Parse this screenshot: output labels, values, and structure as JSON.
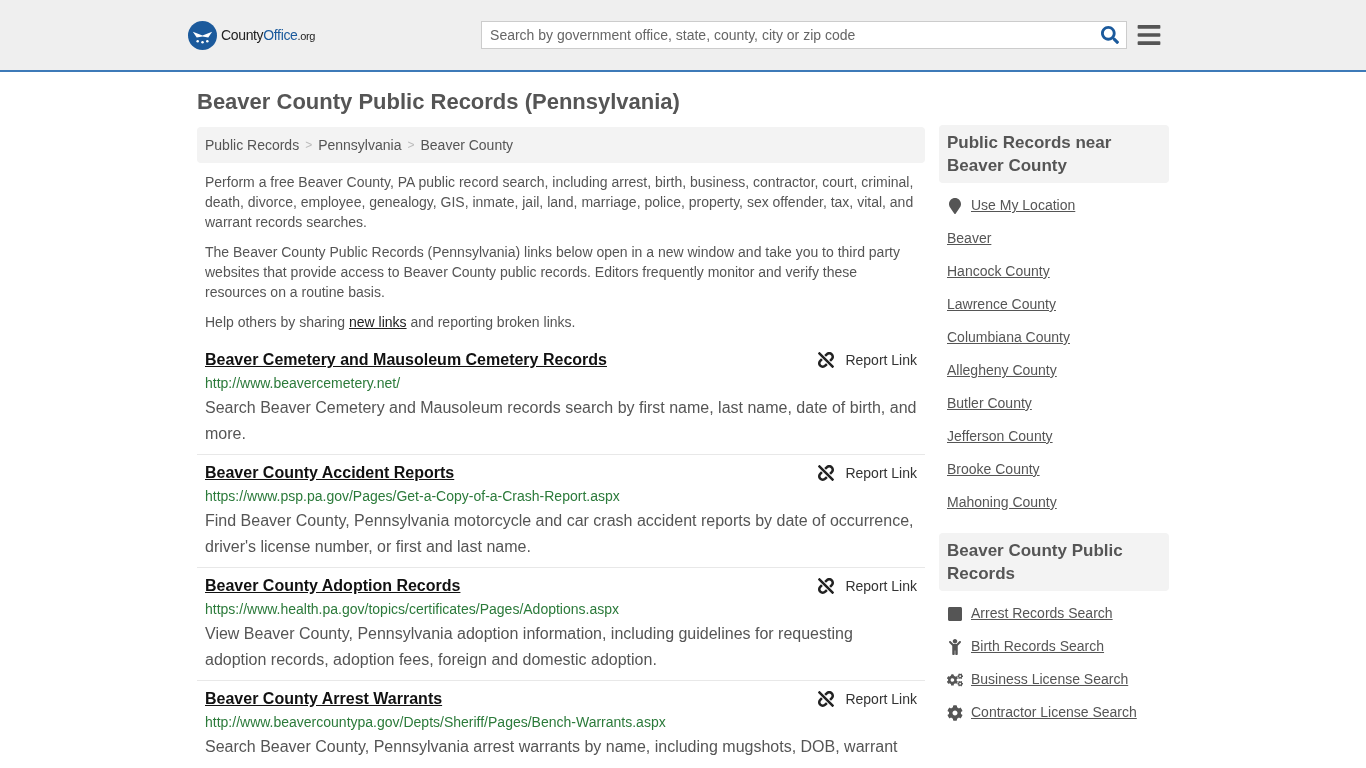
{
  "header": {
    "logo": {
      "part1": "County",
      "part2": "Office",
      "suffix": ".org"
    },
    "search": {
      "placeholder": "Search by government office, state, county, city or zip code"
    }
  },
  "title": "Beaver County Public Records (Pennsylvania)",
  "breadcrumbs": [
    "Public Records",
    "Pennsylvania",
    "Beaver County"
  ],
  "breadcrumb_separator": ">",
  "intro": [
    "Perform a free Beaver County, PA public record search, including arrest, birth, business, contractor, court, criminal, death, divorce, employee, genealogy, GIS, inmate, jail, land, marriage, police, property, sex offender, tax, vital, and warrant records searches.",
    "The Beaver County Public Records (Pennsylvania) links below open in a new window and take you to third party websites that provide access to Beaver County public records. Editors frequently monitor and verify these resources on a routine basis."
  ],
  "help": {
    "before": "Help others by sharing",
    "link": "new links",
    "after": "and reporting broken links."
  },
  "records": [
    {
      "title": "Beaver Cemetery and Mausoleum Cemetery Records",
      "report": "Report Link",
      "url": "http://www.beavercemetery.net/",
      "description": "Search Beaver Cemetery and Mausoleum records search by first name, last name, date of birth, and more."
    },
    {
      "title": "Beaver County Accident Reports",
      "report": "Report Link",
      "url": "https://www.psp.pa.gov/Pages/Get-a-Copy-of-a-Crash-Report.aspx",
      "description": "Find Beaver County, Pennsylvania motorcycle and car crash accident reports by date of occurrence, driver's license number, or first and last name."
    },
    {
      "title": "Beaver County Adoption Records",
      "report": "Report Link",
      "url": "https://www.health.pa.gov/topics/certificates/Pages/Adoptions.aspx",
      "description": "View Beaver County, Pennsylvania adoption information, including guidelines for requesting adoption records, adoption fees, foreign and domestic adoption."
    },
    {
      "title": "Beaver County Arrest Warrants",
      "report": "Report Link",
      "url": "http://www.beavercountypa.gov/Depts/Sheriff/Pages/Bench-Warrants.aspx",
      "description": "Search Beaver County, Pennsylvania arrest warrants by name, including mugshots, DOB, warrant"
    }
  ],
  "sidebar": [
    {
      "heading": "Public Records near Beaver County",
      "items": [
        {
          "label": "Use My Location",
          "kind": "location"
        },
        {
          "label": "Beaver",
          "kind": "plain"
        },
        {
          "label": "Hancock County",
          "kind": "plain"
        },
        {
          "label": "Lawrence County",
          "kind": "plain"
        },
        {
          "label": "Columbiana County",
          "kind": "plain"
        },
        {
          "label": "Allegheny County",
          "kind": "plain"
        },
        {
          "label": "Butler County",
          "kind": "plain"
        },
        {
          "label": "Jefferson County",
          "kind": "plain"
        },
        {
          "label": "Brooke County",
          "kind": "plain"
        },
        {
          "label": "Mahoning County",
          "kind": "plain"
        }
      ]
    },
    {
      "heading": "Beaver County Public Records",
      "items": [
        {
          "label": "Arrest Records Search",
          "kind": "square"
        },
        {
          "label": "Birth Records Search",
          "kind": "person"
        },
        {
          "label": "Business License Search",
          "kind": "gears"
        },
        {
          "label": "Contractor License Search",
          "kind": "gear"
        }
      ]
    }
  ]
}
